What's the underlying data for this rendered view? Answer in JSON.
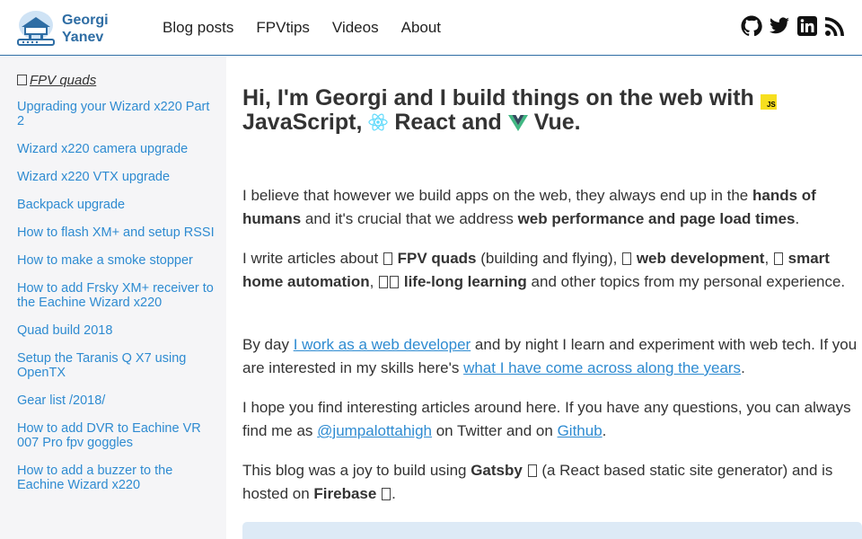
{
  "brand": {
    "line1": "Georgi",
    "line2": "Yanev"
  },
  "nav": [
    "Blog posts",
    "FPVtips",
    "Videos",
    "About"
  ],
  "social": [
    "github-icon",
    "twitter-icon",
    "linkedin-icon",
    "rss-icon"
  ],
  "sidebar": {
    "category": "FPV quads",
    "items": [
      "Upgrading your Wizard x220 Part 2",
      "Wizard x220 camera upgrade",
      "Wizard x220 VTX upgrade",
      "Backpack upgrade",
      "How to flash XM+ and setup RSSI",
      "How to make a smoke stopper",
      "How to add Frsky XM+ receiver to the Eachine Wizard x220",
      "Quad build 2018",
      "Setup the Taranis Q X7 using OpenTX",
      "Gear list /2018/",
      "How to add DVR to Eachine VR 007 Pro fpv goggles",
      "How to add a buzzer to the Eachine Wizard x220"
    ]
  },
  "hero": {
    "part1": "Hi, I'm Georgi and I build things on the web with",
    "js_badge": "JS",
    "part2": "JavaScript,",
    "part3": "React and",
    "part4": "Vue."
  },
  "p1": {
    "t1": "I believe that however we build apps on the web, they always end up in the ",
    "b1": "hands of humans",
    "t2": " and it's crucial that we address ",
    "b2": "web performance and page load times",
    "t3": "."
  },
  "p2": {
    "t1": "I write articles about ",
    "b1": "FPV quads",
    "t2": " (building and flying), ",
    "b2": "web development",
    "t3": ", ",
    "b3": "smart home automation",
    "t4": ", ",
    "b4": "life-long learning",
    "t5": " and other topics from my personal experience."
  },
  "p3": {
    "t1": "By day ",
    "l1": "I work as a web developer",
    "t2": " and by night I learn and experiment with web tech. If you are interested in my skills here's ",
    "l2": "what I have come across along the years",
    "t3": "."
  },
  "p4": {
    "t1": "I hope you find interesting articles around here. If you have any questions, you can always find me as ",
    "l1": "@jumpalottahigh",
    "t2": " on Twitter and on ",
    "l2": "Github",
    "t3": "."
  },
  "p5": {
    "t1": "This blog was a joy to build using ",
    "b1": "Gatsby",
    "t2": " (a React based static site generator) and is hosted on ",
    "b2": "Firebase",
    "t3": "."
  },
  "colors": {
    "accent": "#2e8bd1",
    "brand": "#2e6da4",
    "sidebar_bg": "#f5f5f7"
  }
}
